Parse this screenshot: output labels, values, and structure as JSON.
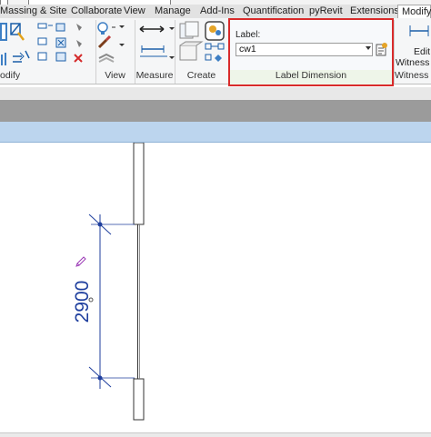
{
  "tabs": [
    "Massing & Site",
    "Collaborate",
    "View",
    "Manage",
    "Add-Ins",
    "Quantification",
    "pyRevit",
    "Extensions",
    "Modify"
  ],
  "active_tab": "Modify",
  "panels": {
    "modify": "odify",
    "view": "View",
    "measure": "Measure",
    "create": "Create",
    "label_dimension": "Label Dimension",
    "witness": "Witness L"
  },
  "label_dimension": {
    "caption": "Label:",
    "selected_label": "cw1"
  },
  "edit_witness": {
    "line1": "Edit",
    "line2": "Witness L"
  },
  "dimension": {
    "value": "2900"
  },
  "colors": {
    "highlight_border": "#d92b2b",
    "dimension_blue": "#1f3f9e",
    "view_bar": "#bcd5ee"
  }
}
